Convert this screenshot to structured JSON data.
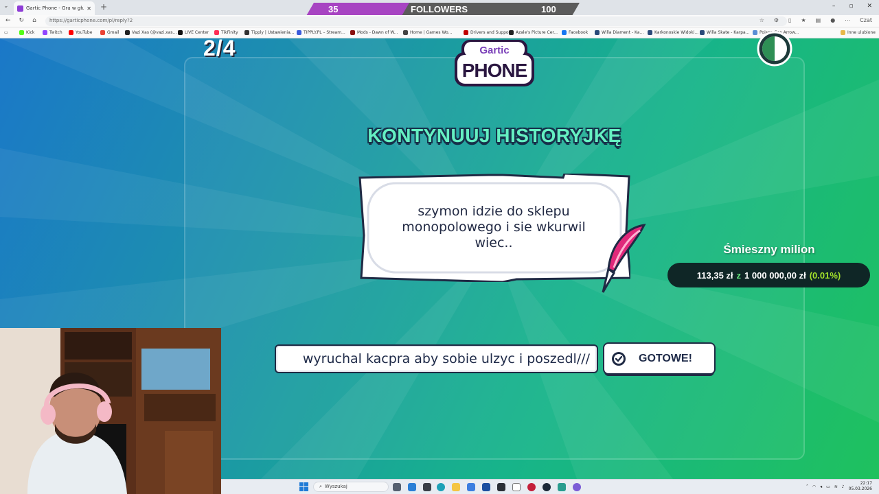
{
  "browser": {
    "tab_title": "Gartic Phone - Gra w głuchy telef...",
    "url": "https://garticphone.com/pl/reply?2",
    "bookmarks": [
      {
        "label": "Kick",
        "color": "#53fc18"
      },
      {
        "label": "Twitch",
        "color": "#9146ff"
      },
      {
        "label": "YouTube",
        "color": "#ff0000"
      },
      {
        "label": "Gmail",
        "color": "#ea4335"
      },
      {
        "label": "Vazi Xas (@vazi.xas...",
        "color": "#222222"
      },
      {
        "label": "LIVE Center",
        "color": "#111111"
      },
      {
        "label": "TikFinity",
        "color": "#ff2d55"
      },
      {
        "label": "Tipply | Ustawienia...",
        "color": "#333333"
      },
      {
        "label": "TIPPLY.PL – Stream...",
        "color": "#3b5bdb"
      },
      {
        "label": "Mods - Dawn of W...",
        "color": "#8b1010"
      },
      {
        "label": "Home | Games Wo...",
        "color": "#444444"
      },
      {
        "label": "Drivers and Suppo...",
        "color": "#c00000"
      },
      {
        "label": "Azale's Picture Cer...",
        "color": "#222222"
      },
      {
        "label": "Facebook",
        "color": "#1877f2"
      },
      {
        "label": "Willa Diament - Ka...",
        "color": "#2b4a7a"
      },
      {
        "label": "Karkonoskie Widoki...",
        "color": "#2b4a7a"
      },
      {
        "label": "Willa Skate - Karpa...",
        "color": "#2b4a7a"
      },
      {
        "label": "Poison Gas Arrow...",
        "color": "#5a8fd6"
      }
    ],
    "bookmarks_other": "Inne ulubione",
    "chat_label": "Czat"
  },
  "followers_bar": {
    "current": "35",
    "label": "FOLLOWERS",
    "goal": "100",
    "progress_fraction": 0.35
  },
  "game": {
    "round": "2/4",
    "logo_line1": "Gartic",
    "logo_line2": "PHONE",
    "heading": "KONTYNUUJ HISTORYJKĘ",
    "story_text": "szymon idzie do sklepu monopolowego i sie wkurwil wiec..",
    "input_value": "wyruchal kacpra aby sobie ulzyc i poszedl///",
    "ready_button": "GOTOWE!",
    "timer_fraction_remaining": 0.5
  },
  "million": {
    "title": "Śmieszny milion",
    "current": "113,35 zł",
    "separator": "z",
    "goal": "1 000 000,00 zł",
    "percent": "(0.01%)",
    "progress_fraction": 0.0001
  },
  "taskbar": {
    "search_placeholder": "Wyszukaj",
    "time": "22:17",
    "date": "05.03.2026"
  }
}
